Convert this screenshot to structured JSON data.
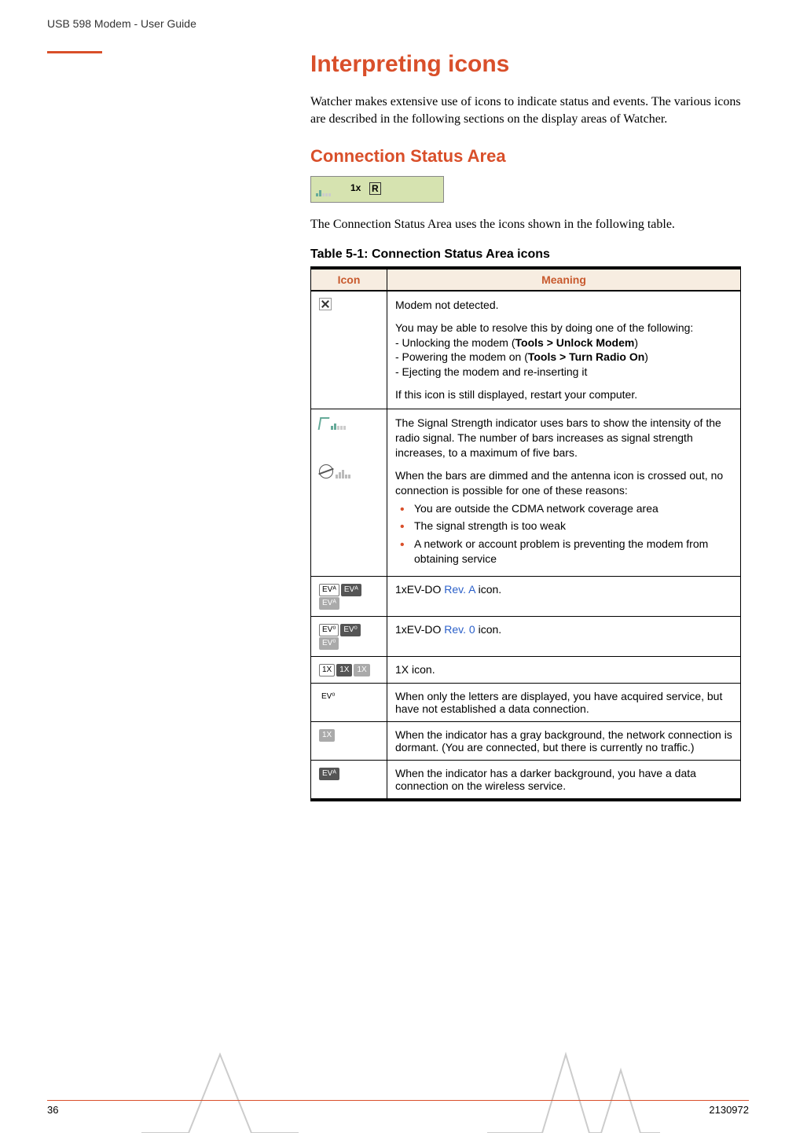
{
  "header": {
    "running": "USB 598 Modem - User Guide"
  },
  "h1": "Interpreting icons",
  "intro": "Watcher makes extensive use of icons to indicate status and events. The various icons are described in the following sections on the display areas of Watcher.",
  "h2": "Connection Status Area",
  "after_image": "The Connection Status Area uses the icons shown in the following table.",
  "table": {
    "caption": "Table 5-1:  Connection Status Area icons",
    "head": {
      "icon": "Icon",
      "meaning": "Meaning"
    },
    "rows": {
      "r1": {
        "p1": "Modem not detected.",
        "p2": "You may be able to resolve this by doing one of the following:",
        "line1a": "- Unlocking the modem (",
        "line1b": "Tools > Unlock Modem",
        "line1c": ")",
        "line2a": "- Powering the modem on (",
        "line2b": "Tools > Turn Radio On",
        "line2c": ")",
        "line3": "- Ejecting the modem and re-inserting it",
        "p3": "If this icon is still displayed, restart your computer."
      },
      "r2": {
        "p1": "The Signal Strength indicator uses bars to show the intensity of the radio signal. The number of bars increases as signal strength increases, to a maximum of five bars.",
        "p2": "When the bars are dimmed and the antenna icon is crossed out, no connection is possible for one of these reasons:",
        "b1": "You are outside the CDMA network coverage area",
        "b2": "The signal strength is too weak",
        "b3": "A network or account problem is preventing the modem from obtaining service"
      },
      "r3": {
        "pre": "1xEV-DO ",
        "link": "Rev. A",
        "post": " icon."
      },
      "r4": {
        "pre": "1xEV-DO ",
        "link": "Rev. 0",
        "post": " icon."
      },
      "r5": "1X icon.",
      "r6": "When only the letters are displayed, you have acquired service, but have not established a data connection.",
      "r7": "When the indicator has a gray background, the network connection is dormant. (You are connected, but there is currently no traffic.)",
      "r8": "When the indicator has a darker background, you have a data connection on the wireless service."
    },
    "icon_labels": {
      "eva": "EVᴬ",
      "ev0": "EV⁰",
      "onex": "1X"
    }
  },
  "footer": {
    "page": "36",
    "doc": "2130972"
  }
}
